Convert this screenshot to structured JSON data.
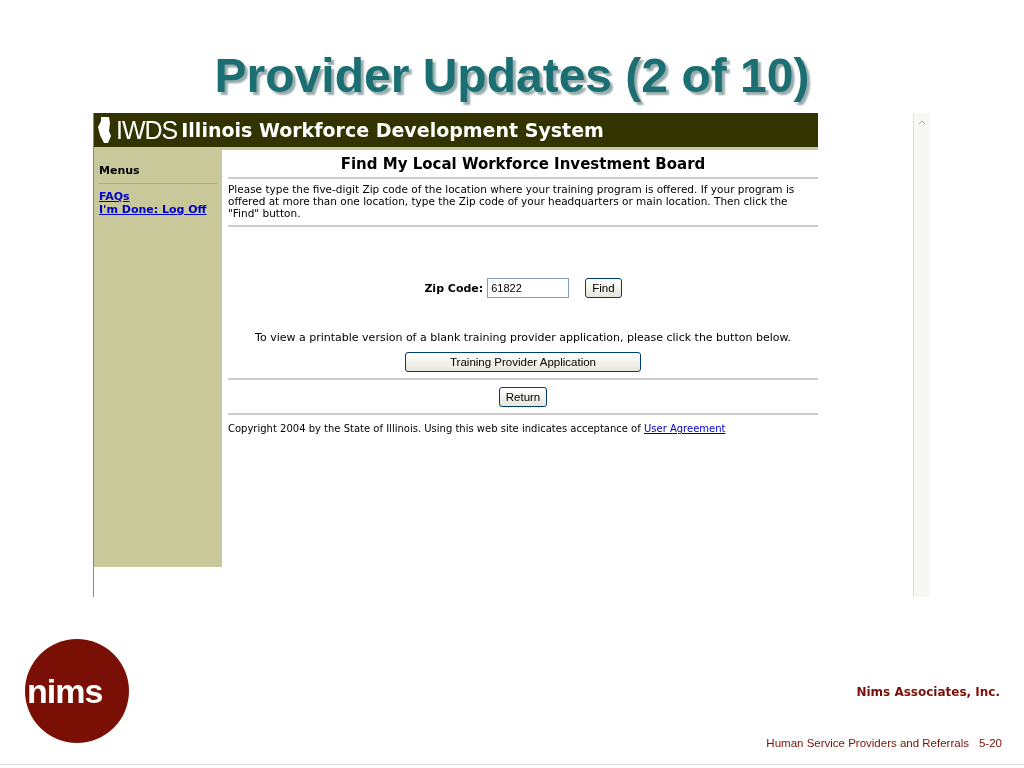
{
  "slide": {
    "title": "Provider Updates (2 of 10)"
  },
  "site": {
    "logo_text": "IWDS",
    "title": "Illinois Workforce Development System"
  },
  "sidebar": {
    "heading": "Menus",
    "links": [
      "FAQs",
      "I'm Done: Log Off"
    ]
  },
  "page": {
    "heading": "Find My Local Workforce Investment Board",
    "instructions": "Please type the five-digit Zip code of the location where your training program is offered.  If your program is offered at more than one location, type the Zip code of your headquarters or main location.  Then click the \"Find\" button.",
    "zip_label": "Zip Code:",
    "zip_value": "61822",
    "find_button": "Find",
    "printable_note": "To view a printable version of a blank training provider application, please click the button below.",
    "application_button": "Training Provider Application",
    "return_button": "Return",
    "copyright": "Copyright 2004 by the State of Illinois. Using this web site indicates acceptance of",
    "agreement_link": "User Agreement"
  },
  "footer": {
    "logo_text": "nims",
    "company": "Nims Associates, Inc.",
    "caption": "Human Service Providers and Referrals",
    "page_number": "5-20"
  }
}
